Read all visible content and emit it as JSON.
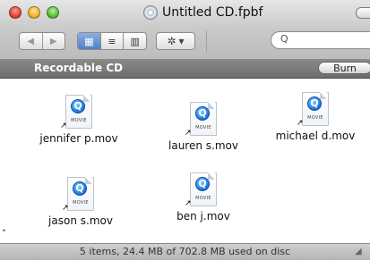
{
  "window": {
    "title": "Untitled CD.fpbf"
  },
  "toolbar": {
    "back_icon": "◀",
    "forward_icon": "▶",
    "view_icon_mode": "▦",
    "view_list_mode": "≡",
    "view_column_mode": "▥",
    "action_icon": "✲",
    "action_chevron": "▾",
    "search_glyph": "Q"
  },
  "cd_bar": {
    "label": "Recordable CD",
    "burn_label": "Burn"
  },
  "files": [
    {
      "name": "jennifer p.mov"
    },
    {
      "name": "lauren s.mov"
    },
    {
      "name": "michael d.mov"
    },
    {
      "name": "jason s.mov"
    },
    {
      "name": "ben j.mov"
    }
  ],
  "icon_text": {
    "movie_caption": "MOVIE",
    "quicktime_glyph": "Q",
    "alias_arrow": "↗"
  },
  "status": {
    "text": "5 items, 24.4 MB of 702.8 MB used on disc"
  },
  "colors": {
    "selected_view": "#4f80c8",
    "cd_bar": "#6d6d6d"
  }
}
